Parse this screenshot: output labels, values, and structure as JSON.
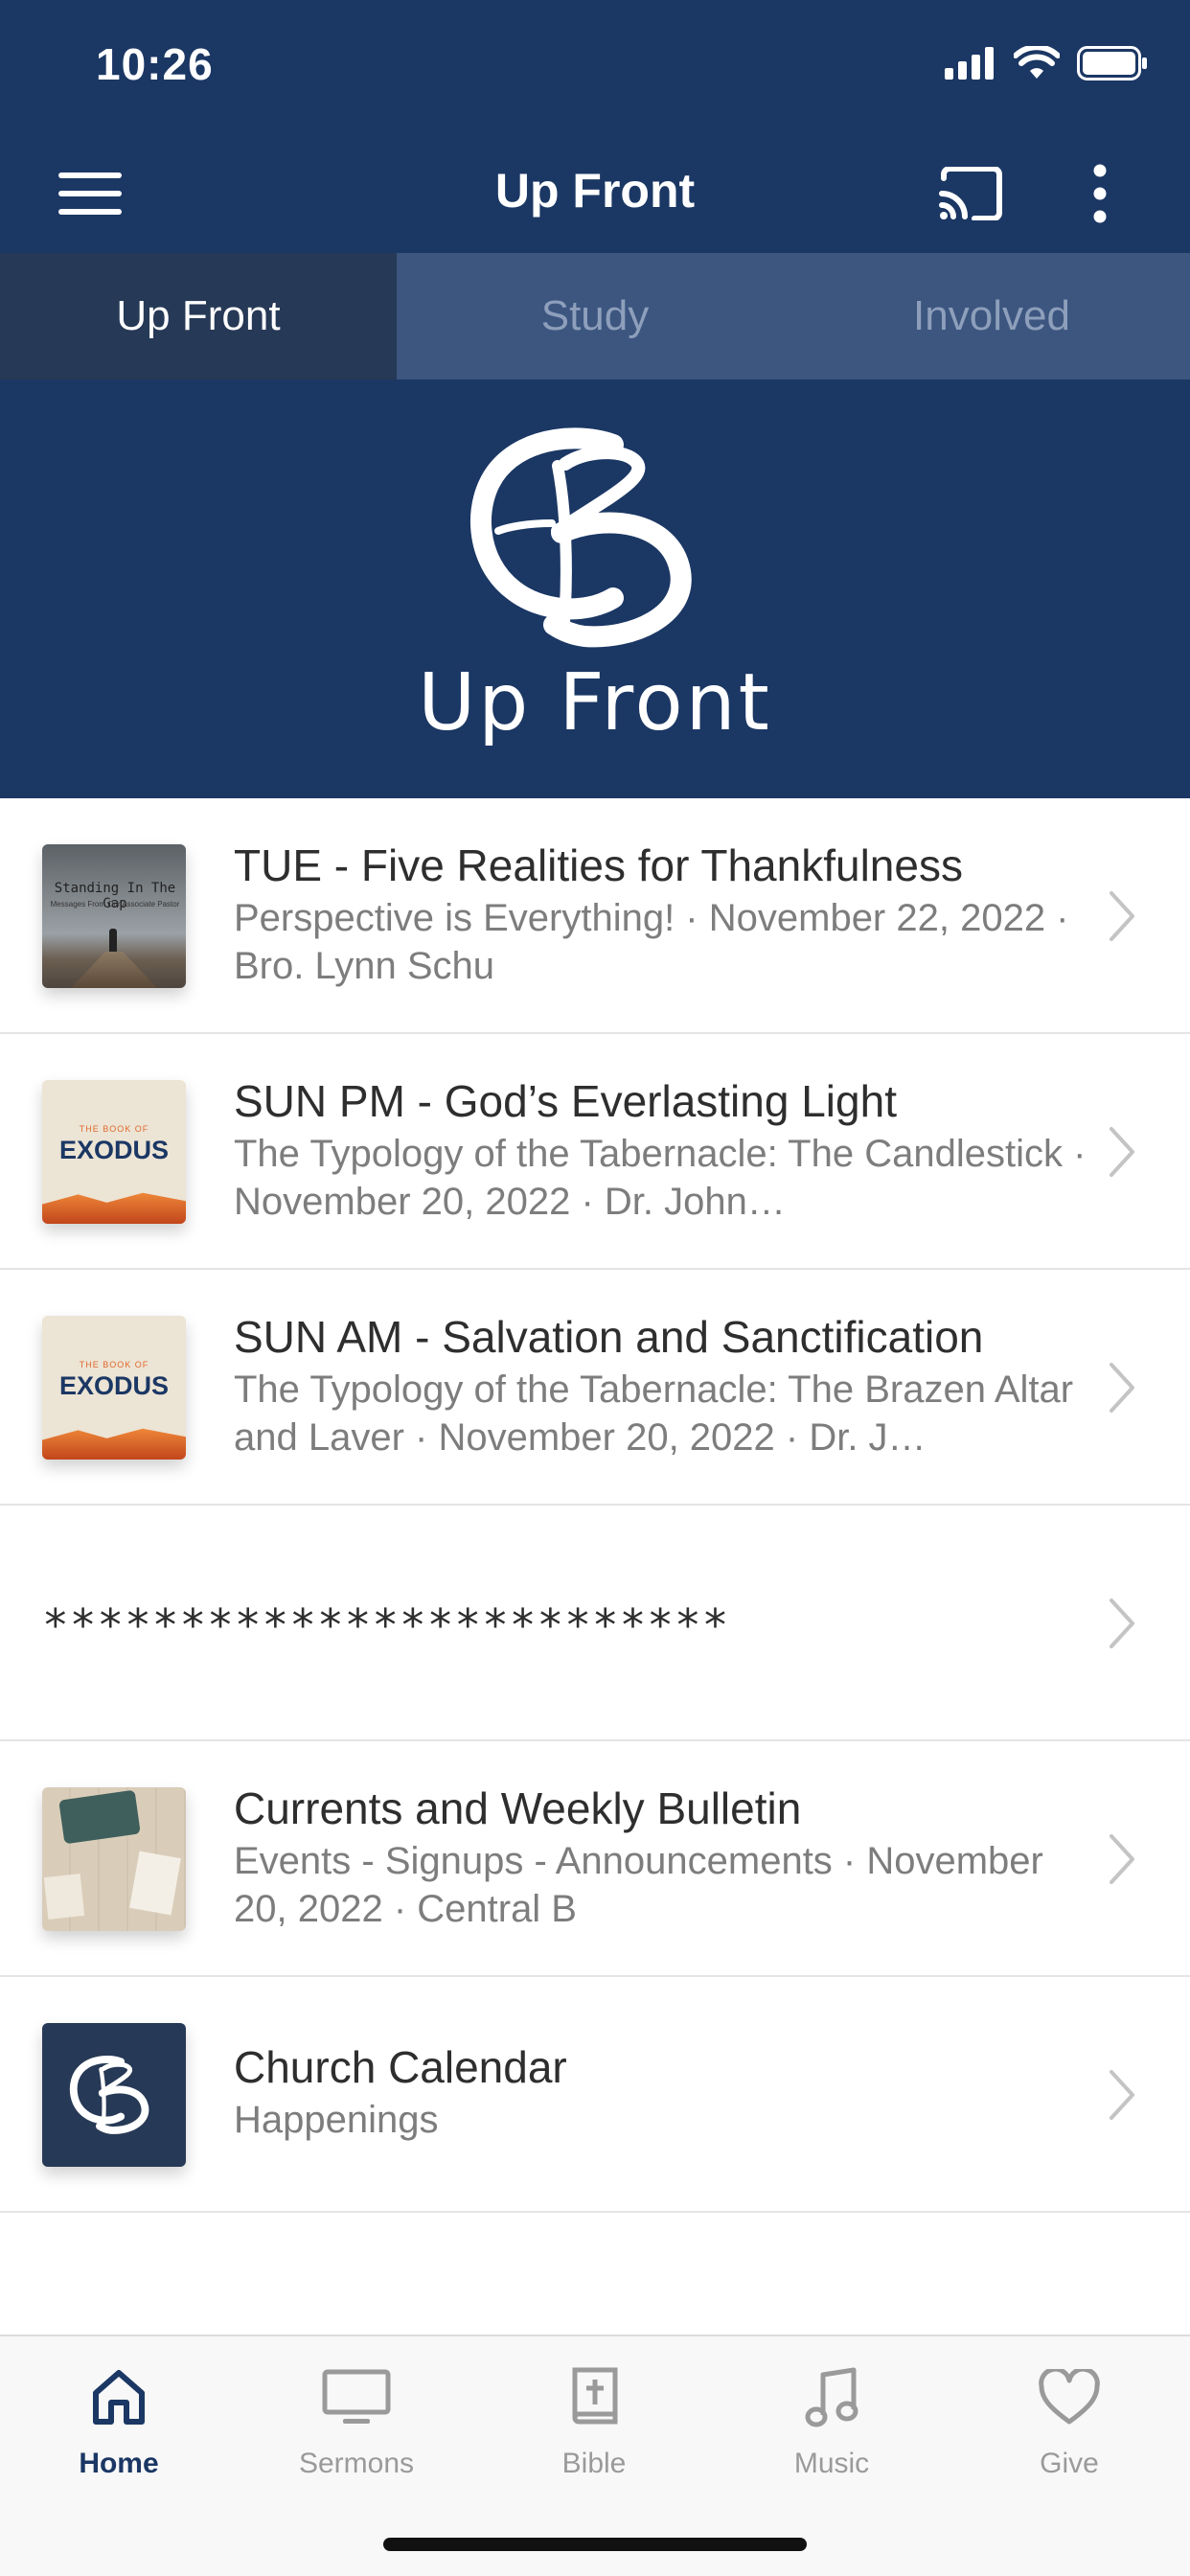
{
  "status": {
    "time": "10:26"
  },
  "navbar": {
    "title": "Up Front",
    "menu_icon": "hamburger-menu-icon",
    "cast_icon": "cast-icon",
    "more_icon": "more-vertical-icon"
  },
  "tabs": [
    {
      "label": "Up Front",
      "active": true
    },
    {
      "label": "Study",
      "active": false
    },
    {
      "label": "Involved",
      "active": false
    }
  ],
  "hero": {
    "title": "Up Front",
    "logo_icon": "cb-logo"
  },
  "items": [
    {
      "title": "TUE - Five Realities for Thankfulness",
      "subtitle": "Perspective is Everything! · November 22, 2022 · Bro. Lynn Schu",
      "thumb": "standing-in-the-gap",
      "thumb_title": "Standing In The Gap",
      "thumb_sub": "Messages From Our Associate Pastor"
    },
    {
      "title": "SUN PM - God’s Everlasting Light",
      "subtitle": "The Typology of the Tabernacle: The Candlestick · November 20, 2022 · Dr. John…",
      "thumb": "exodus",
      "thumb_small": "THE BOOK OF",
      "thumb_big": "EXODUS"
    },
    {
      "title": "SUN AM - Salvation and Sanctification",
      "subtitle": "The Typology of the Tabernacle: The Brazen Altar and Laver · November 20, 2022 · Dr. J…",
      "thumb": "exodus",
      "thumb_small": "THE BOOK OF",
      "thumb_big": "EXODUS"
    },
    {
      "title": "*************************"
    },
    {
      "title": "Currents and Weekly Bulletin",
      "subtitle": "Events - Signups - Announcements · November 20, 2022 · Central B",
      "thumb": "typewriter"
    },
    {
      "title": "Church Calendar",
      "subtitle": "Happenings",
      "thumb": "cb-logo"
    }
  ],
  "tabbar": [
    {
      "label": "Home",
      "icon": "home-icon",
      "active": true
    },
    {
      "label": "Sermons",
      "icon": "monitor-icon",
      "active": false
    },
    {
      "label": "Bible",
      "icon": "bible-icon",
      "active": false
    },
    {
      "label": "Music",
      "icon": "music-note-icon",
      "active": false
    },
    {
      "label": "Give",
      "icon": "heart-icon",
      "active": false
    }
  ],
  "colors": {
    "navy": "#1b3764",
    "tab_active": "#263956",
    "tab_inactive": "#3c5680",
    "exodus_orange": "#e06a2c"
  }
}
